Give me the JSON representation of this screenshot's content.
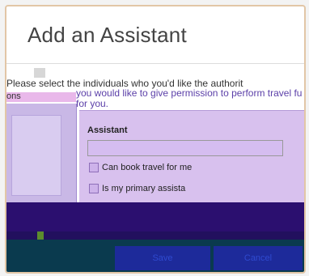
{
  "dialog": {
    "title": "Add an Assistant",
    "instruction_line1": "Please select the individuals who you'd like the authorit",
    "instruction_line2": "you would like to give permission to perform travel fu",
    "instruction_line3": "for you.",
    "left_fragment": "ons"
  },
  "form": {
    "assistant_label": "Assistant",
    "assistant_value": "",
    "can_book_label": "Can book travel for me",
    "primary_label": "Is my primary assista"
  },
  "footer": {
    "save_label": "Save",
    "cancel_label": "Cancel"
  }
}
